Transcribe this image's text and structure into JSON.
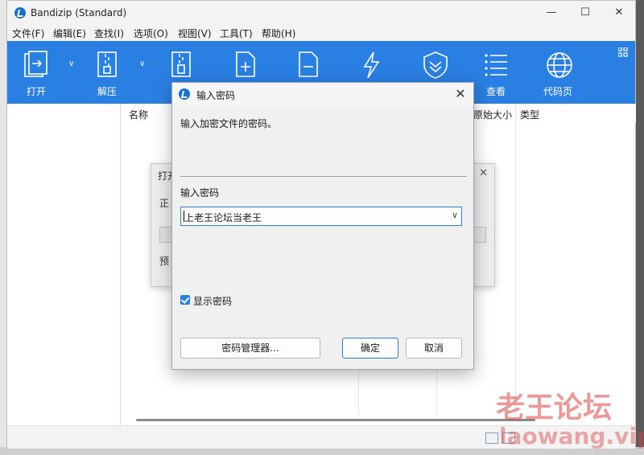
{
  "window": {
    "title": "Bandizip (Standard)",
    "controls": {
      "minimize": "—",
      "maximize": "☐",
      "close": "✕"
    }
  },
  "menu": [
    "文件(F)",
    "编辑(E)",
    "查找(I)",
    "选项(O)",
    "视图(V)",
    "工具(T)",
    "帮助(H)"
  ],
  "toolbar": {
    "open": "打开",
    "extract": "解压",
    "view": "查看",
    "codepage": "代码页"
  },
  "list": {
    "col_name": "名称",
    "col_size": "原始大小",
    "col_type": "类型"
  },
  "background_dialog": {
    "title": "打开",
    "label1": "正",
    "label2": "预"
  },
  "dialog": {
    "title": "输入密码",
    "description": "输入加密文件的密码。",
    "field_label": "输入密码",
    "password_value": "上老王论坛当老王",
    "show_password_label": "显示密码",
    "show_password_checked": true,
    "manager_button": "密码管理器...",
    "ok_button": "确定",
    "cancel_button": "取消"
  },
  "watermark": {
    "text": "老王论坛",
    "url": "laowang.vip"
  },
  "colors": {
    "accent": "#2a7fe2",
    "toolbar_bg": "#2a7fe2"
  }
}
